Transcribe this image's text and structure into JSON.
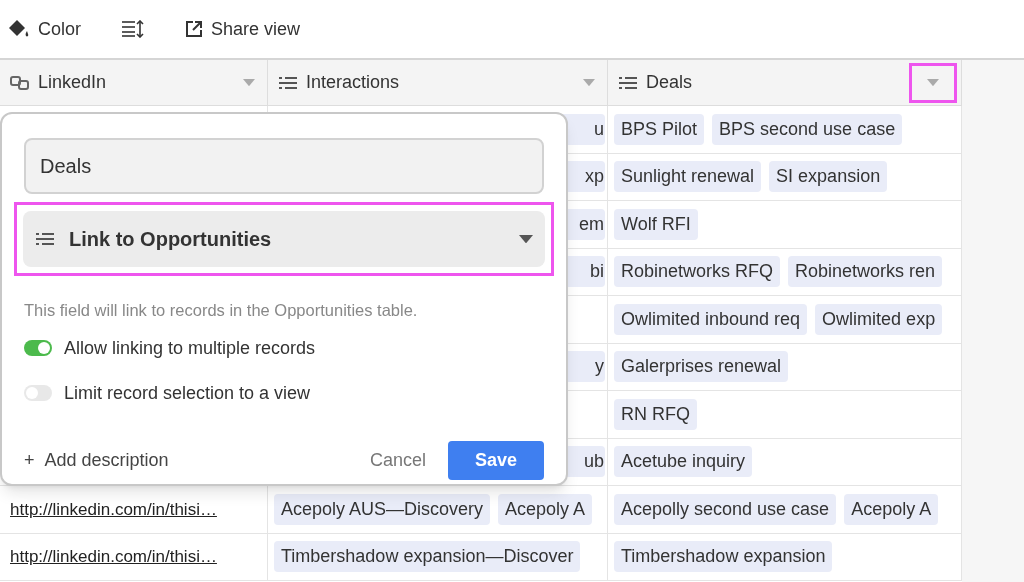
{
  "toolbar": {
    "color_button": "Color",
    "share_button": "Share view"
  },
  "columns": [
    {
      "kind": "url",
      "label": "LinkedIn",
      "highlighted": false
    },
    {
      "kind": "link",
      "label": "Interactions",
      "highlighted": false
    },
    {
      "kind": "link",
      "label": "Deals",
      "highlighted": true
    }
  ],
  "rows": [
    {
      "interactions": [
        "u"
      ],
      "deals": [
        "BPS Pilot",
        "BPS second use case"
      ]
    },
    {
      "interactions": [
        "xp"
      ],
      "deals": [
        "Sunlight renewal",
        "SI expansion"
      ]
    },
    {
      "interactions": [
        "em"
      ],
      "deals": [
        "Wolf RFI"
      ]
    },
    {
      "interactions": [
        "bi"
      ],
      "deals": [
        "Robinetworks RFQ",
        "Robinetworks ren"
      ]
    },
    {
      "deals": [
        "Owlimited inbound req",
        "Owlimited exp"
      ]
    },
    {
      "interactions": [
        "y"
      ],
      "deals": [
        "Galerprises renewal"
      ]
    },
    {
      "deals": [
        "RN RFQ"
      ]
    },
    {
      "interactions": [
        "ub"
      ],
      "deals": [
        "Acetube inquiry"
      ]
    },
    {
      "linkedin": "http://linkedin.com/in/thisi…",
      "interactions": [
        "Acepoly AUS—Discovery",
        "Acepoly A"
      ],
      "deals": [
        "Acepolly second use case",
        "Acepoly A"
      ]
    },
    {
      "linkedin": "http://linkedin.com/in/thisi…",
      "interactions": [
        "Timbershadow expansion—Discover"
      ],
      "deals": [
        "Timbershadow expansion"
      ]
    }
  ],
  "popover": {
    "name_value": "Deals",
    "type_select": {
      "label": "Link to Opportunities",
      "highlighted": true
    },
    "description": "This field will link to records in the Opportunities table.",
    "options": [
      {
        "label": "Allow linking to multiple records",
        "on": true
      },
      {
        "label": "Limit record selection to a view",
        "on": false
      }
    ],
    "add_description": "Add description",
    "add_icon": "+",
    "cancel": "Cancel",
    "save": "Save"
  }
}
